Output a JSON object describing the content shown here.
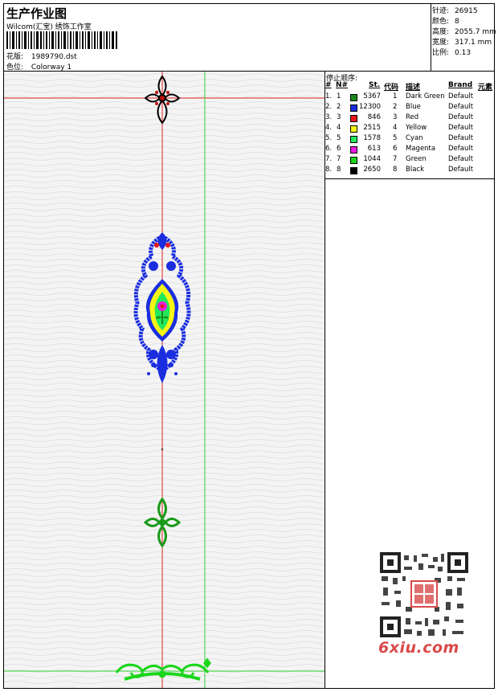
{
  "header": {
    "title": "生产作业图",
    "subtitle": "Wilcom(汇宝) 绣饰工作室",
    "design_label": "花版:",
    "design_value": "1989790.dst",
    "colorway_label": "色位:",
    "colorway_value": "Colorway 1"
  },
  "stats": [
    {
      "label": "针迹:",
      "value": "26915"
    },
    {
      "label": "颜色:",
      "value": "8"
    },
    {
      "label": "高度:",
      "value": "2055.7 mm"
    },
    {
      "label": "宽度:",
      "value": "317.1 mm"
    },
    {
      "label": "比例:",
      "value": "0.13"
    }
  ],
  "stop_sequence": {
    "heading": "停止顺序:",
    "columns": [
      "#",
      "N#",
      "St.",
      "代码",
      "描述",
      "Brand",
      "元素"
    ],
    "rows": [
      {
        "idx": "1.",
        "n": "1",
        "stitches": "5367",
        "code": "1",
        "desc": "Dark Green",
        "brand": "Default",
        "color": "#1a8a1a"
      },
      {
        "idx": "2.",
        "n": "2",
        "stitches": "12300",
        "code": "2",
        "desc": "Blue",
        "brand": "Default",
        "color": "#1a2ee0"
      },
      {
        "idx": "3.",
        "n": "3",
        "stitches": "846",
        "code": "3",
        "desc": "Red",
        "brand": "Default",
        "color": "#e81818"
      },
      {
        "idx": "4.",
        "n": "4",
        "stitches": "2515",
        "code": "4",
        "desc": "Yellow",
        "brand": "Default",
        "color": "#f5f516"
      },
      {
        "idx": "5.",
        "n": "5",
        "stitches": "1578",
        "code": "5",
        "desc": "Cyan",
        "brand": "Default",
        "color": "#22e85a"
      },
      {
        "idx": "6.",
        "n": "6",
        "stitches": "613",
        "code": "6",
        "desc": "Magenta",
        "brand": "Default",
        "color": "#e81ae0"
      },
      {
        "idx": "7.",
        "n": "7",
        "stitches": "1044",
        "code": "7",
        "desc": "Green",
        "brand": "Default",
        "color": "#1ad61a"
      },
      {
        "idx": "8.",
        "n": "8",
        "stitches": "2650",
        "code": "8",
        "desc": "Black",
        "brand": "Default",
        "color": "#000000"
      }
    ]
  },
  "watermark": "6xiu.com"
}
